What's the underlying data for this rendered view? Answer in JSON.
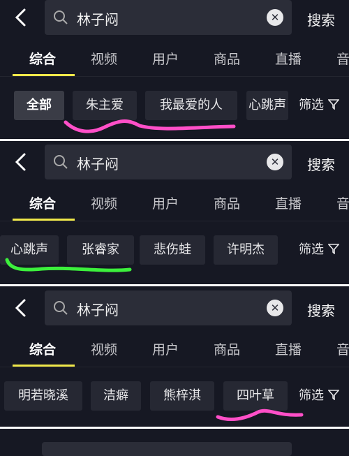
{
  "search": {
    "query": "林子闷",
    "button": "搜索"
  },
  "tabs": [
    "综合",
    "视频",
    "用户",
    "商品",
    "直播",
    "音"
  ],
  "filter_label": "筛选",
  "panels": [
    {
      "chips": [
        "全部",
        "朱主爱",
        "我最爱的人",
        "心跳声"
      ]
    },
    {
      "chips": [
        "心跳声",
        "张睿家",
        "悲伤蛙",
        "许明杰"
      ]
    },
    {
      "chips": [
        "明若晓溪",
        "洁癖",
        "熊梓淇",
        "四叶草"
      ]
    }
  ],
  "colors": {
    "background": "#161823",
    "tab_underline": "#f0e84a",
    "pink_marker": "#ff4fc8",
    "green_marker": "#3cf03c"
  },
  "icons": [
    "back-arrow-icon",
    "search-icon",
    "clear-icon",
    "filter-funnel-icon"
  ]
}
